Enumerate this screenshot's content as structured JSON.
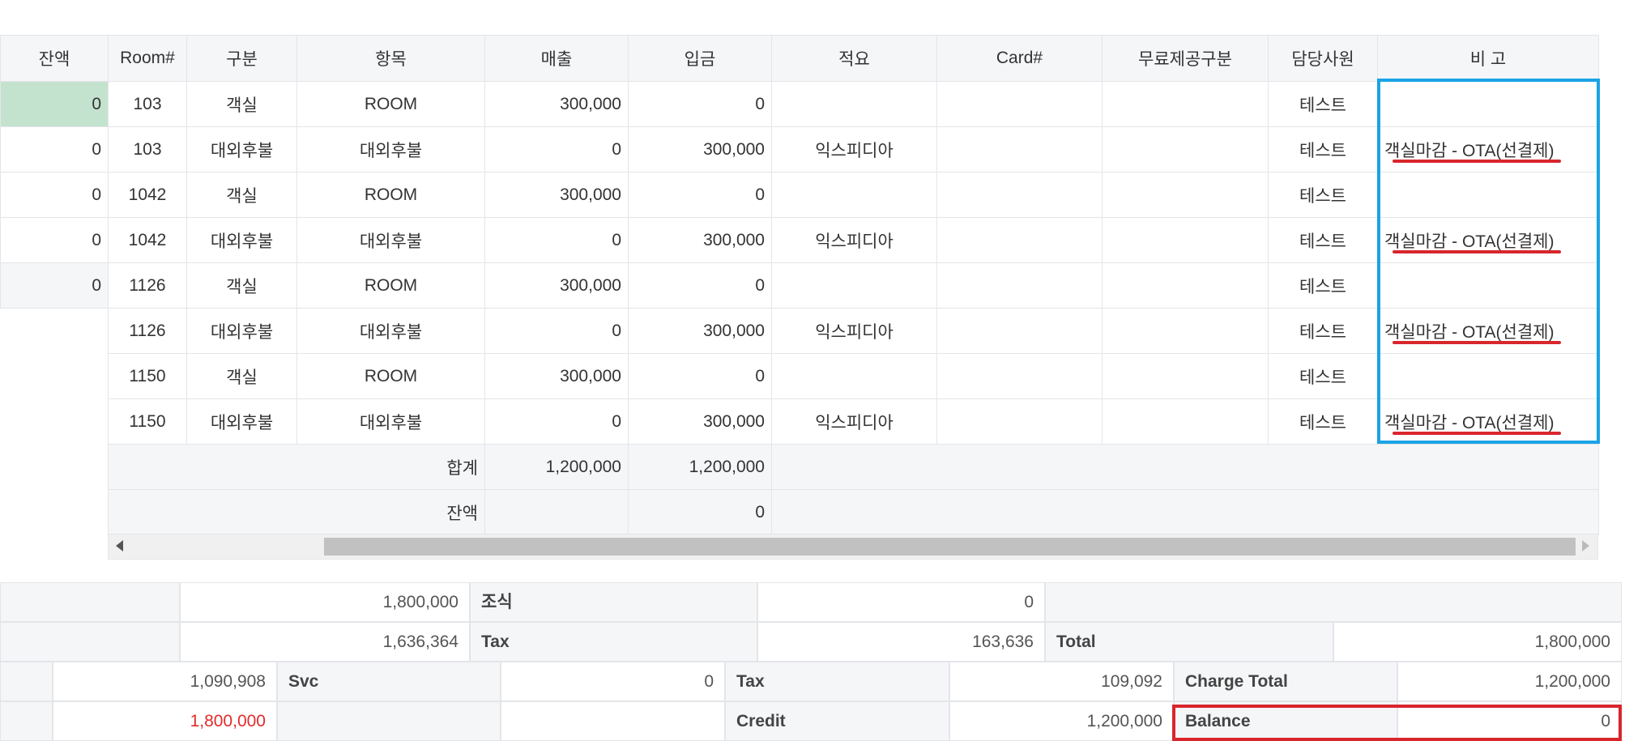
{
  "grid": {
    "left_header": "잔액",
    "left_values": [
      "0",
      "0",
      "0",
      "0",
      "0"
    ],
    "headers": [
      "Room#",
      "구분",
      "항목",
      "매출",
      "입금",
      "적요",
      "Card#",
      "무료제공구분",
      "담당사원",
      "비 고"
    ],
    "rows": [
      {
        "room": "103",
        "type": "객실",
        "item": "ROOM",
        "sales": "300,000",
        "deposit": "0",
        "memo": "",
        "card": "",
        "free": "",
        "staff": "테스트",
        "note": ""
      },
      {
        "room": "103",
        "type": "대외후불",
        "item": "대외후불",
        "sales": "0",
        "deposit": "300,000",
        "memo": "익스피디아",
        "card": "",
        "free": "",
        "staff": "테스트",
        "note": "객실마감 - OTA(선결제)"
      },
      {
        "room": "1042",
        "type": "객실",
        "item": "ROOM",
        "sales": "300,000",
        "deposit": "0",
        "memo": "",
        "card": "",
        "free": "",
        "staff": "테스트",
        "note": ""
      },
      {
        "room": "1042",
        "type": "대외후불",
        "item": "대외후불",
        "sales": "0",
        "deposit": "300,000",
        "memo": "익스피디아",
        "card": "",
        "free": "",
        "staff": "테스트",
        "note": "객실마감 - OTA(선결제)"
      },
      {
        "room": "1126",
        "type": "객실",
        "item": "ROOM",
        "sales": "300,000",
        "deposit": "0",
        "memo": "",
        "card": "",
        "free": "",
        "staff": "테스트",
        "note": ""
      },
      {
        "room": "1126",
        "type": "대외후불",
        "item": "대외후불",
        "sales": "0",
        "deposit": "300,000",
        "memo": "익스피디아",
        "card": "",
        "free": "",
        "staff": "테스트",
        "note": "객실마감 - OTA(선결제)"
      },
      {
        "room": "1150",
        "type": "객실",
        "item": "ROOM",
        "sales": "300,000",
        "deposit": "0",
        "memo": "",
        "card": "",
        "free": "",
        "staff": "테스트",
        "note": ""
      },
      {
        "room": "1150",
        "type": "대외후불",
        "item": "대외후불",
        "sales": "0",
        "deposit": "300,000",
        "memo": "익스피디아",
        "card": "",
        "free": "",
        "staff": "테스트",
        "note": "객실마감 - OTA(선결제)"
      }
    ],
    "total_label": "합계",
    "total_sales": "1,200,000",
    "total_deposit": "1,200,000",
    "balance_label": "잔액",
    "balance_value": "0"
  },
  "summary": {
    "row1": {
      "value1": "1,800,000",
      "label": "조식",
      "value2": "0"
    },
    "row2": {
      "value1": "1,636,364",
      "label": "Tax",
      "value2": "163,636",
      "total_label": "Total",
      "total_value": "1,800,000"
    },
    "row3": {
      "value1": "1,090,908",
      "svc_label": "Svc",
      "svc_value": "0",
      "tax_label": "Tax",
      "tax_value": "109,092",
      "charge_label": "Charge Total",
      "charge_value": "1,200,000"
    },
    "row4": {
      "value1": "1,800,000",
      "credit_label": "Credit",
      "credit_value": "1,200,000",
      "balance_label": "Balance",
      "balance_value": "0"
    }
  },
  "colors": {
    "highlight_blue": "#1aa3e6",
    "highlight_red": "#d8262c",
    "balance_green": "#c4e3cf",
    "alert_red": "#e52b2b"
  }
}
